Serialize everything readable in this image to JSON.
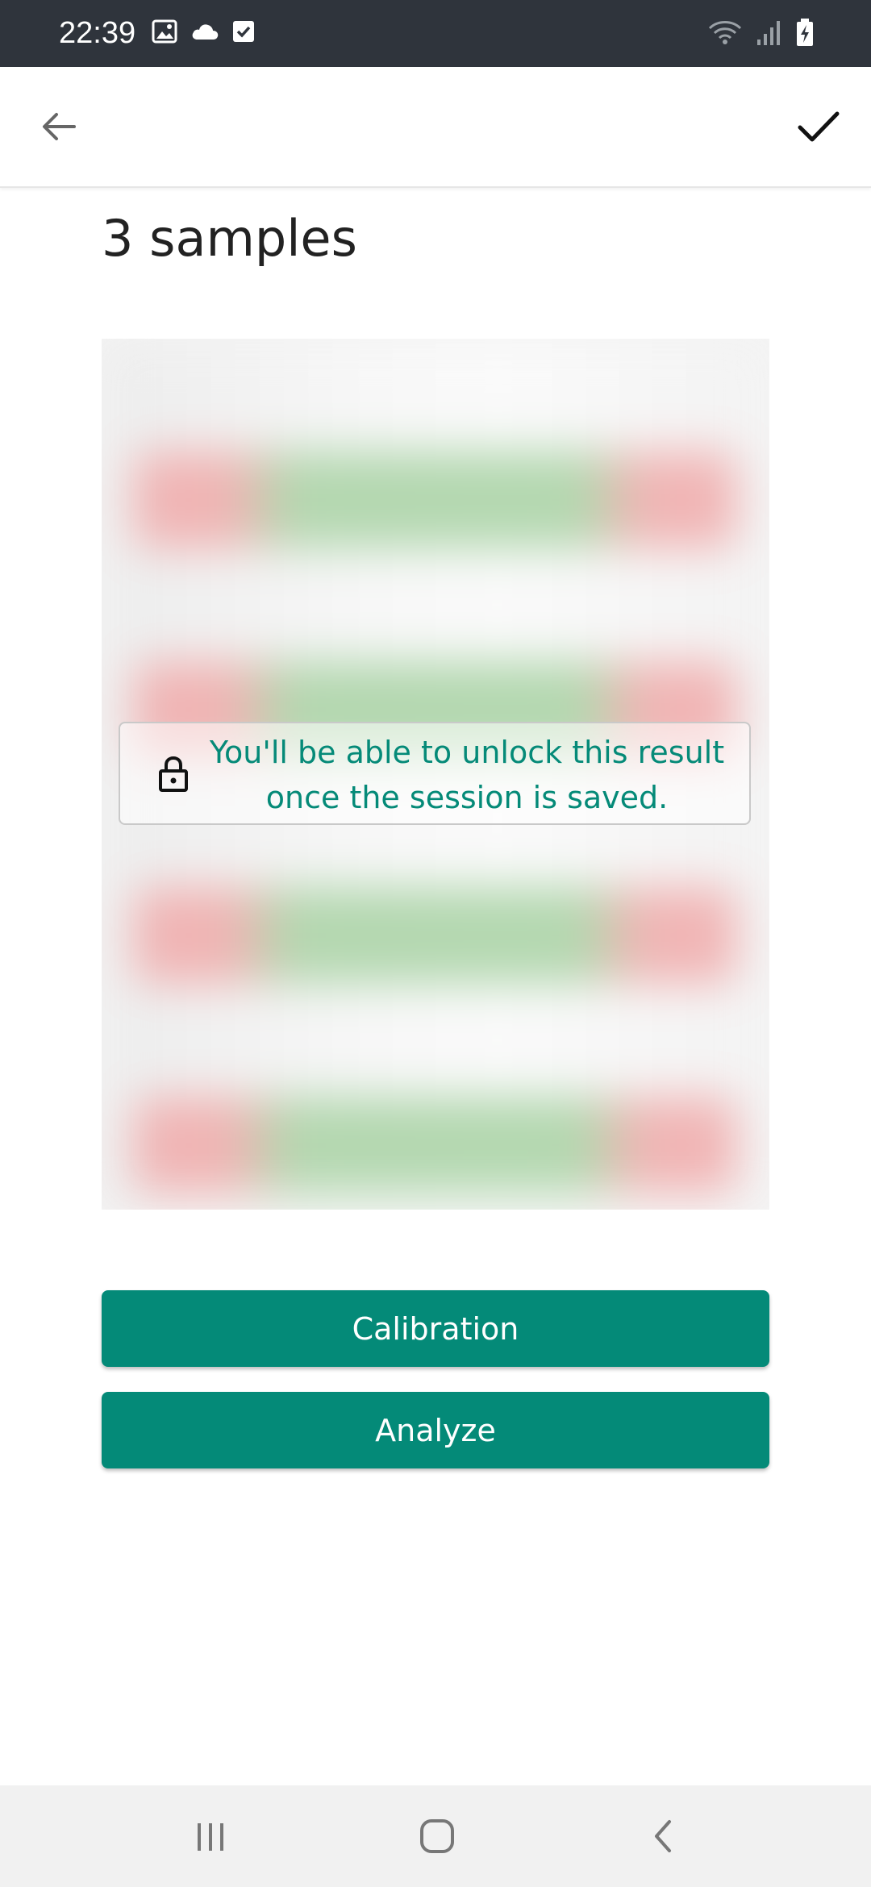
{
  "status_bar": {
    "time": "22:39",
    "left_icons": [
      "image-icon",
      "cloud-icon",
      "checkbox-icon"
    ],
    "right_icons": [
      "wifi-icon",
      "signal-icon",
      "battery-charging-icon"
    ]
  },
  "app_bar": {
    "back_icon": "arrow-left-icon",
    "confirm_icon": "check-icon"
  },
  "main": {
    "title": "3 samples",
    "lock_notice": "You'll be able to unlock this result once the session is saved.",
    "lock_icon": "lock-icon"
  },
  "buttons": {
    "calibration_label": "Calibration",
    "analyze_label": "Analyze"
  },
  "nav_bar": {
    "icons": [
      "recents-icon",
      "home-icon",
      "back-icon"
    ]
  },
  "colors": {
    "accent": "#048A78",
    "status_bar_bg": "#2F343C",
    "nav_bar_bg": "#F1F1F1"
  }
}
